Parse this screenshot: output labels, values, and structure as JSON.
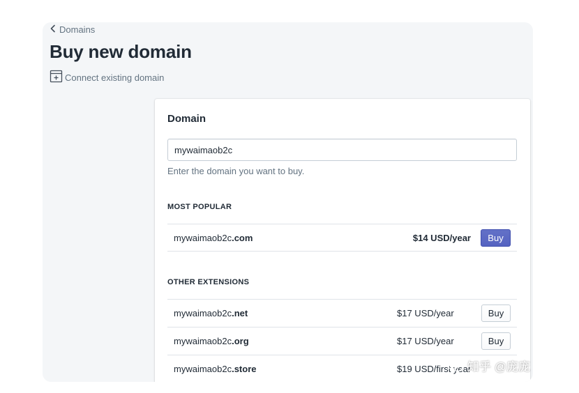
{
  "breadcrumb": {
    "label": "Domains",
    "icon": "chevron-left-icon"
  },
  "page_title": "Buy new domain",
  "connect_link": {
    "label": "Connect existing domain",
    "icon": "add-domain-icon"
  },
  "card": {
    "title": "Domain",
    "input_value": "mywaimaob2c",
    "help_text": "Enter the domain you want to buy.",
    "most_popular": {
      "heading": "MOST POPULAR",
      "items": [
        {
          "base": "mywaimaob2c",
          "ext": ".com",
          "price": "$14 USD/year",
          "button": "Buy"
        }
      ]
    },
    "other": {
      "heading": "OTHER EXTENSIONS",
      "items": [
        {
          "base": "mywaimaob2c",
          "ext": ".net",
          "price": "$17 USD/year",
          "button": "Buy"
        },
        {
          "base": "mywaimaob2c",
          "ext": ".org",
          "price": "$17 USD/year",
          "button": "Buy"
        },
        {
          "base": "mywaimaob2c",
          "ext": ".store",
          "price": "$19 USD/first year"
        }
      ]
    }
  },
  "watermark": "知乎 @庞庞",
  "colors": {
    "primary": "#5c6ac4",
    "page_bg": "#f4f6f8",
    "text": "#212b36",
    "subdued": "#637381"
  }
}
